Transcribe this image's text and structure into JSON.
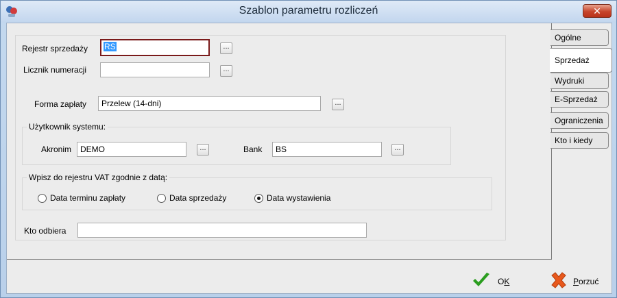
{
  "window": {
    "title": "Szablon parametru rozliczeń",
    "close_label": "✕"
  },
  "form": {
    "rejestr": {
      "label": "Rejestr sprzedaży",
      "value": "RS",
      "button": "..."
    },
    "licznik": {
      "label": "Licznik numeracji",
      "value": "",
      "button": "..."
    },
    "forma": {
      "label": "Forma zapłaty",
      "value": "Przelew (14-dni)",
      "button": "..."
    },
    "uzytkownik": {
      "legend": "Użytkownik systemu:",
      "akronim_label": "Akronim",
      "akronim_value": "DEMO",
      "akronim_button": "...",
      "bank_label": "Bank",
      "bank_value": "BS",
      "bank_button": "..."
    },
    "vat": {
      "legend": "Wpisz do rejestru VAT zgodnie z datą:",
      "options": [
        "Data terminu zapłaty",
        "Data sprzedaży",
        "Data wystawienia"
      ],
      "selected": "Data wystawienia"
    },
    "kto_odbiera": {
      "label": "Kto odbiera",
      "value": ""
    }
  },
  "tabs": [
    "Ogólne",
    "Sprzedaż",
    "Wydruki",
    "E-Sprzedaż",
    "Ograniczenia",
    "Kto i kiedy"
  ],
  "active_tab": "Sprzedaż",
  "footer": {
    "ok_prefix": "O",
    "ok_underlined": "K",
    "cancel_underlined": "P",
    "cancel_suffix": "orzuć"
  },
  "colors": {
    "ok_check": "#2a9d1f",
    "cancel_x": "#e8581c",
    "selection": "#3399ff"
  }
}
